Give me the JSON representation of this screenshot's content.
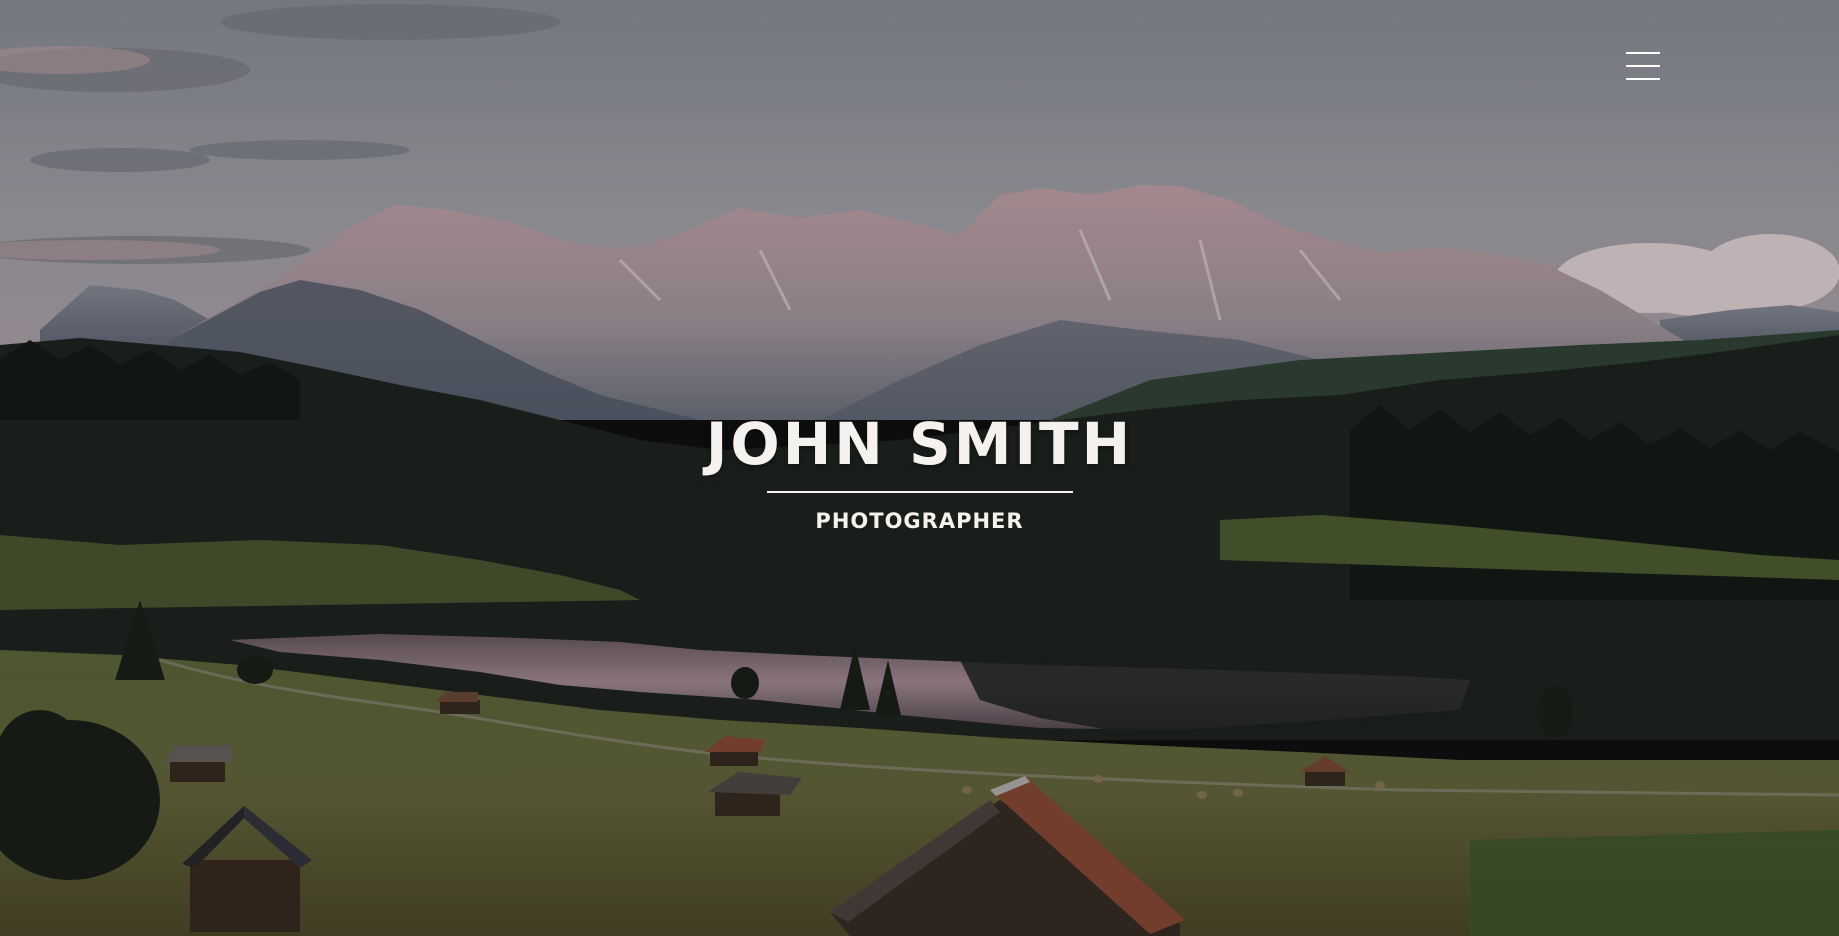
{
  "hero": {
    "name": "JOHN SMITH",
    "role": "PHOTOGRAPHER",
    "background": "mountain-lake-landscape-photo"
  },
  "nav": {
    "menu_icon": "hamburger-menu-icon"
  },
  "colors": {
    "text": "#f4f1ee",
    "sky": "#9aa0aa",
    "mountain": "#c9a9b0",
    "forest": "#1f2620",
    "meadow": "#5f6a3c"
  }
}
